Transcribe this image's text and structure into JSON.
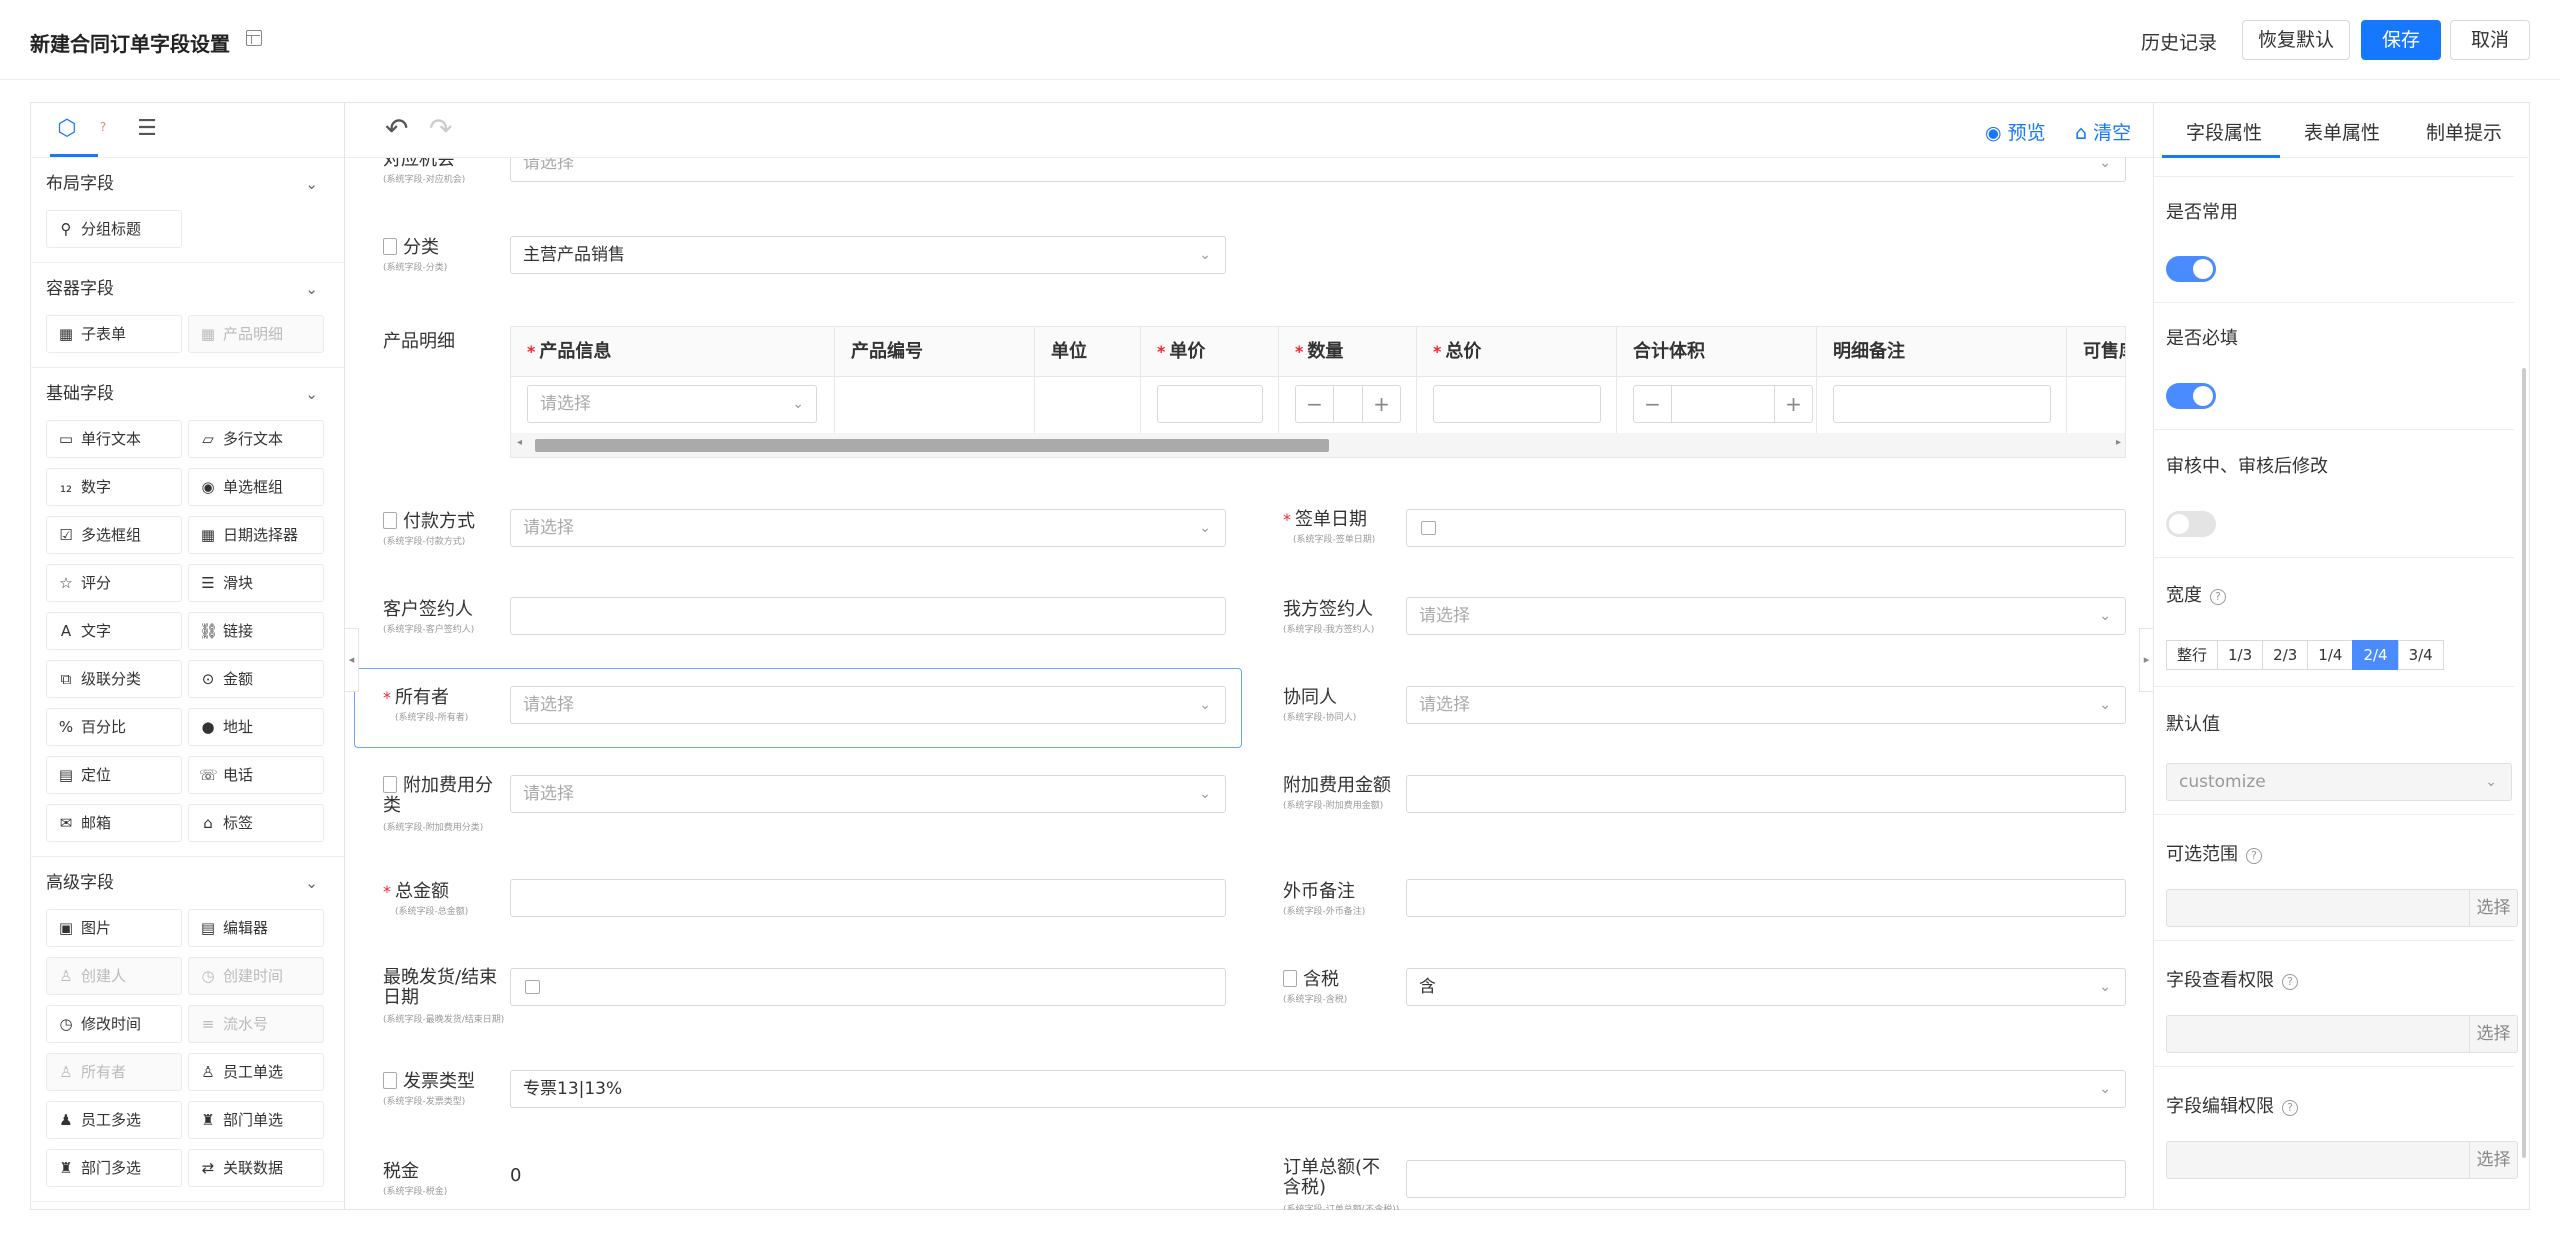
{
  "header": {
    "title": "新建合同订单字段设置",
    "history": "历史记录",
    "restore": "恢复默认",
    "save": "保存",
    "cancel": "取消"
  },
  "left": {
    "sections": [
      {
        "title": "布局字段",
        "items": [
          {
            "label": "分组标题",
            "icon": "group-title-icon",
            "disabled": false
          }
        ]
      },
      {
        "title": "容器字段",
        "items": [
          {
            "label": "子表单",
            "icon": "table-icon",
            "disabled": false
          },
          {
            "label": "产品明细",
            "icon": "table-icon",
            "disabled": true
          }
        ]
      },
      {
        "title": "基础字段",
        "items": [
          {
            "label": "单行文本",
            "icon": "single-line-icon",
            "disabled": false
          },
          {
            "label": "多行文本",
            "icon": "multi-line-icon",
            "disabled": false
          },
          {
            "label": "数字",
            "icon": "number-icon",
            "disabled": false
          },
          {
            "label": "单选框组",
            "icon": "radio-icon",
            "disabled": false
          },
          {
            "label": "多选框组",
            "icon": "checkbox-icon",
            "disabled": false
          },
          {
            "label": "日期选择器",
            "icon": "calendar-icon",
            "disabled": false
          },
          {
            "label": "评分",
            "icon": "star-icon",
            "disabled": false
          },
          {
            "label": "滑块",
            "icon": "slider-icon",
            "disabled": false
          },
          {
            "label": "文字",
            "icon": "text-icon",
            "disabled": false
          },
          {
            "label": "链接",
            "icon": "link-icon",
            "disabled": false
          },
          {
            "label": "级联分类",
            "icon": "cascade-icon",
            "disabled": false
          },
          {
            "label": "金额",
            "icon": "money-icon",
            "disabled": false
          },
          {
            "label": "百分比",
            "icon": "percent-icon",
            "disabled": false
          },
          {
            "label": "地址",
            "icon": "pin-icon",
            "disabled": false
          },
          {
            "label": "定位",
            "icon": "locate-icon",
            "disabled": false
          },
          {
            "label": "电话",
            "icon": "phone-icon",
            "disabled": false
          },
          {
            "label": "邮箱",
            "icon": "mail-icon",
            "disabled": false
          },
          {
            "label": "标签",
            "icon": "tag-icon",
            "disabled": false
          }
        ]
      },
      {
        "title": "高级字段",
        "items": [
          {
            "label": "图片",
            "icon": "image-icon",
            "disabled": false
          },
          {
            "label": "编辑器",
            "icon": "editor-icon",
            "disabled": false
          },
          {
            "label": "创建人",
            "icon": "user-icon",
            "disabled": true
          },
          {
            "label": "创建时间",
            "icon": "clock-icon",
            "disabled": true
          },
          {
            "label": "修改时间",
            "icon": "clock-icon",
            "disabled": false
          },
          {
            "label": "流水号",
            "icon": "list-icon",
            "disabled": true
          },
          {
            "label": "所有者",
            "icon": "user-icon",
            "disabled": true
          },
          {
            "label": "员工单选",
            "icon": "user-icon",
            "disabled": false
          },
          {
            "label": "员工多选",
            "icon": "users-icon",
            "disabled": false
          },
          {
            "label": "部门单选",
            "icon": "dept-icon",
            "disabled": false
          },
          {
            "label": "部门多选",
            "icon": "dept-icon",
            "disabled": false
          },
          {
            "label": "关联数据",
            "icon": "relation-icon",
            "disabled": false
          }
        ]
      }
    ]
  },
  "toolbar": {
    "preview": "预览",
    "clear": "清空"
  },
  "form": {
    "partial_top": {
      "label": "对应机会",
      "sub": "(系统字段-对应机会)",
      "placeholder": "请选择"
    },
    "category": {
      "label": "分类",
      "sub": "(系统字段-分类)",
      "value": "主营产品销售"
    },
    "product_detail": {
      "label": "产品明细",
      "columns": [
        {
          "label": "产品信息",
          "required": true
        },
        {
          "label": "产品编号",
          "required": false
        },
        {
          "label": "单位",
          "required": false
        },
        {
          "label": "单价",
          "required": true
        },
        {
          "label": "数量",
          "required": true
        },
        {
          "label": "总价",
          "required": true
        },
        {
          "label": "合计体积",
          "required": false
        },
        {
          "label": "明细备注",
          "required": false
        },
        {
          "label": "可售库存",
          "required": false
        }
      ],
      "row_placeholder": "请选择"
    },
    "payment": {
      "label": "付款方式",
      "sub": "(系统字段-付款方式)",
      "placeholder": "请选择"
    },
    "sign_date": {
      "label": "签单日期",
      "sub": "(系统字段-签单日期)"
    },
    "customer_signer": {
      "label": "客户签约人",
      "sub": "(系统字段-客户签约人)"
    },
    "our_signer": {
      "label": "我方签约人",
      "sub": "(系统字段-我方签约人)",
      "placeholder": "请选择"
    },
    "owner": {
      "label": "所有者",
      "sub": "(系统字段-所有者)",
      "placeholder": "请选择"
    },
    "collaborator": {
      "label": "协同人",
      "sub": "(系统字段-协同人)",
      "placeholder": "请选择"
    },
    "extra_fee_cat": {
      "label": "附加费用分类",
      "sub": "(系统字段-附加费用分类)",
      "placeholder": "请选择"
    },
    "extra_fee_amt": {
      "label": "附加费用金额",
      "sub": "(系统字段-附加费用金额)"
    },
    "total": {
      "label": "总金额",
      "sub": "(系统字段-总金额)"
    },
    "fx_note": {
      "label": "外币备注",
      "sub": "(系统字段-外币备注)"
    },
    "ship_date": {
      "label": "最晚发货/结束日期",
      "sub": "(系统字段-最晚发货/结束日期)"
    },
    "tax_incl": {
      "label": "含税",
      "sub": "(系统字段-含税)",
      "value": "含"
    },
    "invoice_type": {
      "label": "发票类型",
      "sub": "(系统字段-发票类型)",
      "value": "专票13|13%"
    },
    "tax": {
      "label": "税金",
      "sub": "(系统字段-税金)",
      "value": "0"
    },
    "order_total_ex": {
      "label": "订单总额(不含税)",
      "sub": "(系统字段-订单总额(不含税))"
    }
  },
  "right": {
    "tabs": [
      "字段属性",
      "表单属性",
      "制单提示"
    ],
    "common": "是否常用",
    "required": "是否必填",
    "review_edit": "审核中、审核后修改",
    "width": "宽度",
    "width_options": [
      "整行",
      "1/3",
      "2/3",
      "1/4",
      "2/4",
      "3/4"
    ],
    "width_selected": "2/4",
    "default_value": "默认值",
    "default_select": "customize",
    "range": "可选范围",
    "view_perm": "字段查看权限",
    "edit_perm": "字段编辑权限",
    "pick": "选择",
    "help": "?"
  },
  "colors": {
    "primary": "#1677ff",
    "required": "#f5222d",
    "toggle_on": "#4a8cff"
  }
}
